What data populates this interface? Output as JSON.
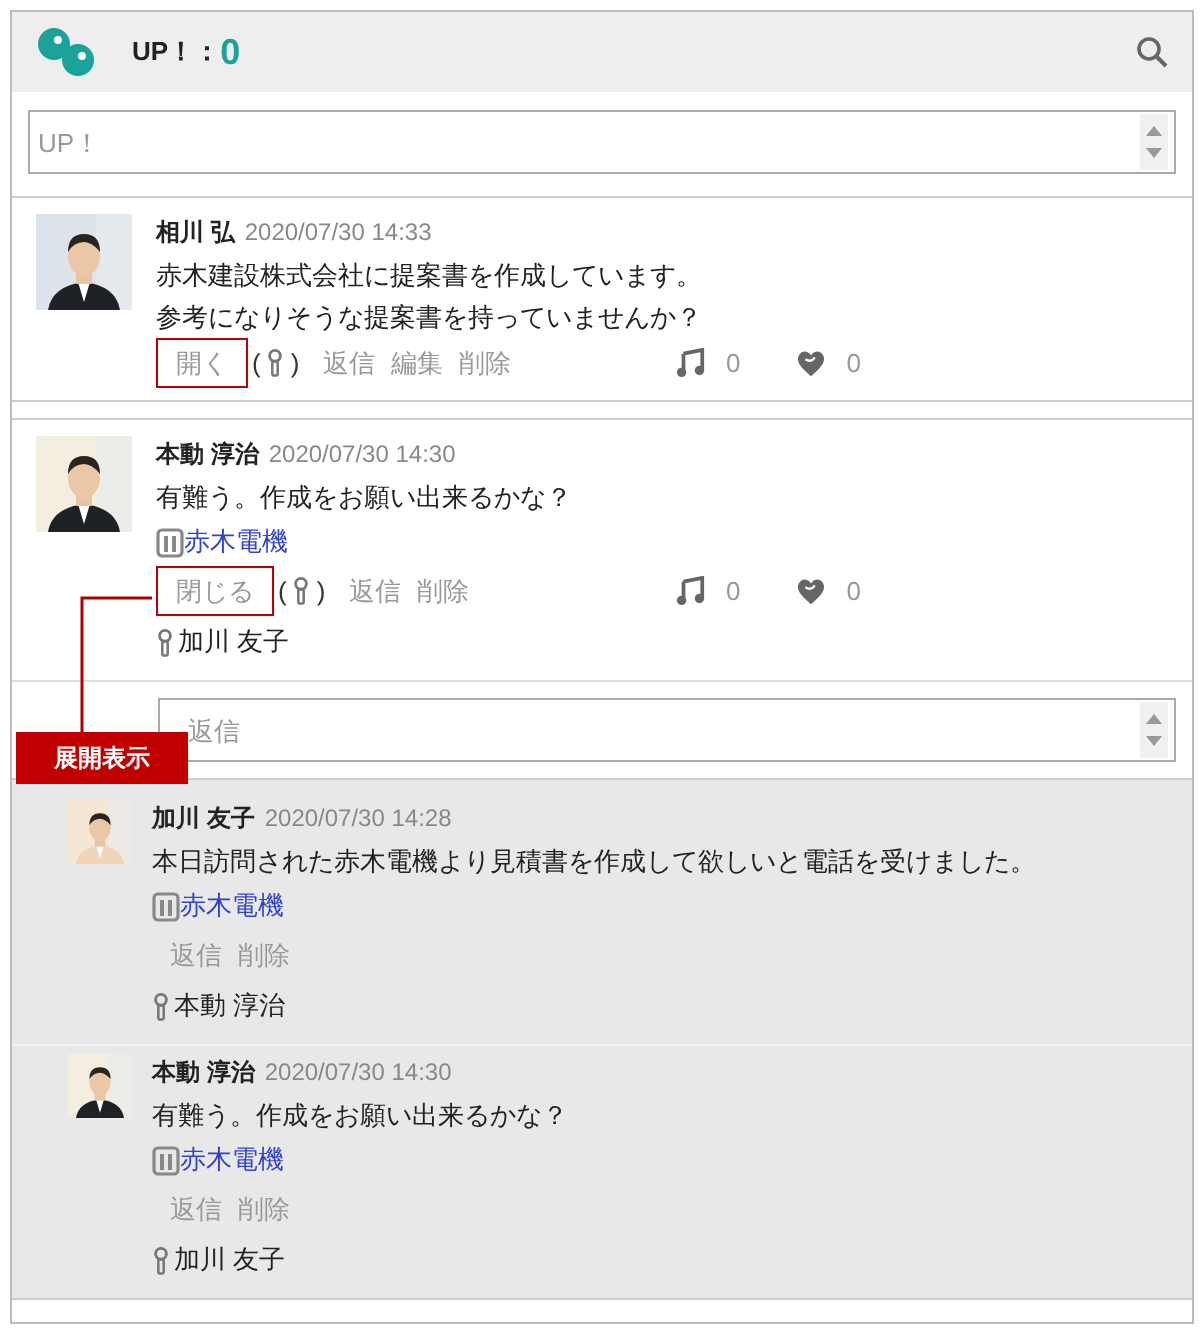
{
  "header": {
    "title": "UP！：",
    "count": "0"
  },
  "compose": {
    "placeholder": "UP！"
  },
  "posts": [
    {
      "author": "相川 弘",
      "time": "2020/07/30 14:33",
      "body": [
        "赤木建設株式会社に提案書を作成しています。",
        "参考になりそうな提案書を持っていませんか？"
      ],
      "toggle": {
        "label": "開く",
        "highlighted": true
      },
      "mention_open": "(",
      "mention_close": ")",
      "actions": [
        "返信",
        "編集",
        "削除"
      ],
      "music_count": "0",
      "heart_count": "0"
    },
    {
      "author": "本動 淳治",
      "time": "2020/07/30 14:30",
      "body": [
        "有難う。作成をお願い出来るかな？"
      ],
      "link": "赤木電機",
      "toggle": {
        "label": "閉じる",
        "highlighted": true
      },
      "mention_open": "(",
      "mention_close": ")",
      "actions": [
        "返信",
        "削除"
      ],
      "music_count": "0",
      "heart_count": "0",
      "mention": "加川 友子",
      "reply_field": {
        "placeholder": "返信"
      },
      "callout": {
        "label": "展開表示"
      },
      "replies": [
        {
          "author": "加川 友子",
          "time": "2020/07/30 14:28",
          "body": "本日訪問された赤木電機より見積書を作成して欲しいと電話を受けました。",
          "link": "赤木電機",
          "actions": [
            "返信",
            "削除"
          ],
          "mention": "本動 淳治"
        },
        {
          "author": "本動 淳治",
          "time": "2020/07/30 14:30",
          "body": "有難う。作成をお願い出来るかな？",
          "link": "赤木電機",
          "actions": [
            "返信",
            "削除"
          ],
          "mention": "加川 友子"
        }
      ]
    }
  ]
}
